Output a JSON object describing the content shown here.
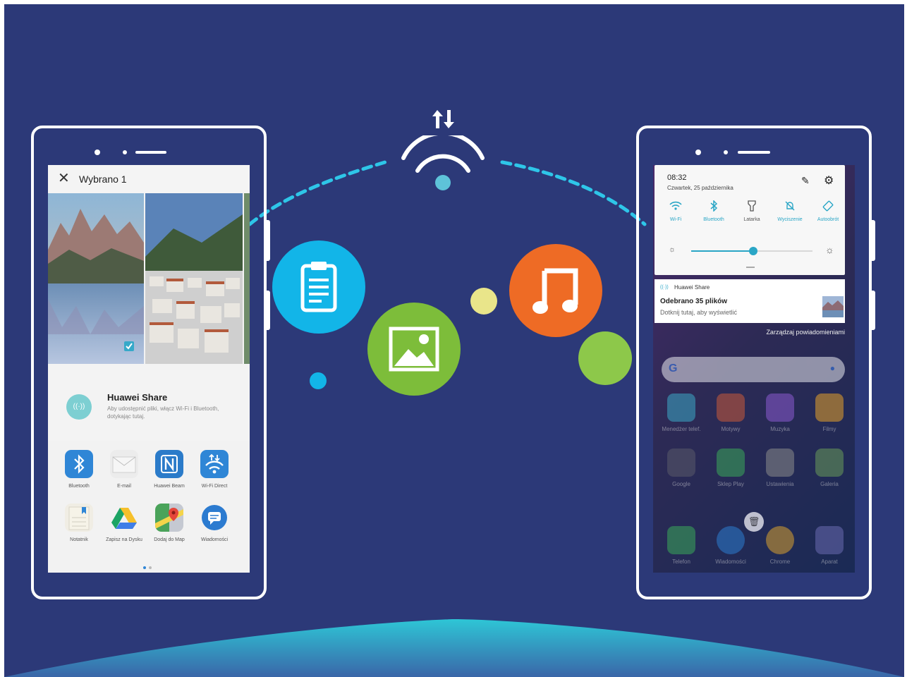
{
  "colors": {
    "background": "#2c3978",
    "accent_blue": "#12b5e8",
    "accent_green": "#7dbd3a",
    "accent_orange": "#ee6b25",
    "dot_yellow": "#e9e58a",
    "dot_green": "#8dc84a",
    "teal_dot": "#5ec3d9",
    "planet_top": "#2ec6d6"
  },
  "icons": [
    "transfer-arrows-icon",
    "wifi-icon",
    "clipboard-icon",
    "image-icon",
    "music-note-icon"
  ],
  "left_phone": {
    "header": {
      "title": "Wybrano 1",
      "close_icon": "close-icon"
    },
    "huawei_share": {
      "title": "Huawei Share",
      "description": "Aby udostępnić pliki, włącz Wi-Fi i Bluetooth, dotykając tutaj."
    },
    "apps": [
      {
        "label": "Bluetooth",
        "icon": "bluetooth-icon"
      },
      {
        "label": "E-mail",
        "icon": "email-icon"
      },
      {
        "label": "Huawei Beam",
        "icon": "nfc-icon"
      },
      {
        "label": "Wi-Fi Direct",
        "icon": "wifi-direct-icon"
      },
      {
        "label": "Notatnik",
        "icon": "notepad-icon"
      },
      {
        "label": "Zapisz na Dysku",
        "icon": "google-drive-icon"
      },
      {
        "label": "Dodaj do Map",
        "icon": "google-maps-icon"
      },
      {
        "label": "Wiadomości",
        "icon": "messages-icon"
      }
    ]
  },
  "right_phone": {
    "quick_settings": {
      "time": "08:32",
      "date": "Czwartek, 25 października",
      "tiles": [
        {
          "label": "Wi-Fi",
          "icon": "wifi-icon"
        },
        {
          "label": "Bluetooth",
          "icon": "bluetooth-icon"
        },
        {
          "label": "Latarka",
          "icon": "flashlight-icon"
        },
        {
          "label": "Wyciszenie",
          "icon": "mute-icon"
        },
        {
          "label": "Autoobrót",
          "icon": "auto-rotate-icon"
        }
      ],
      "brightness_fraction": 0.51
    },
    "notification": {
      "app": "Huawei Share",
      "title": "Odebrano 35 plików",
      "body": "Dotknij tutaj, aby wyświetlić"
    },
    "manage_notifications": "Zarządzaj powiadomieniami",
    "home_apps": [
      {
        "label": "Menedżer telef."
      },
      {
        "label": "Motywy"
      },
      {
        "label": "Muzyka"
      },
      {
        "label": "Filmy"
      },
      {
        "label": "Google"
      },
      {
        "label": "Sklep Play"
      },
      {
        "label": "Ustawienia"
      },
      {
        "label": "Galeria"
      },
      {
        "label": "Telefon"
      },
      {
        "label": "Wiadomości"
      },
      {
        "label": "Chrome"
      },
      {
        "label": "Aparat"
      }
    ]
  }
}
